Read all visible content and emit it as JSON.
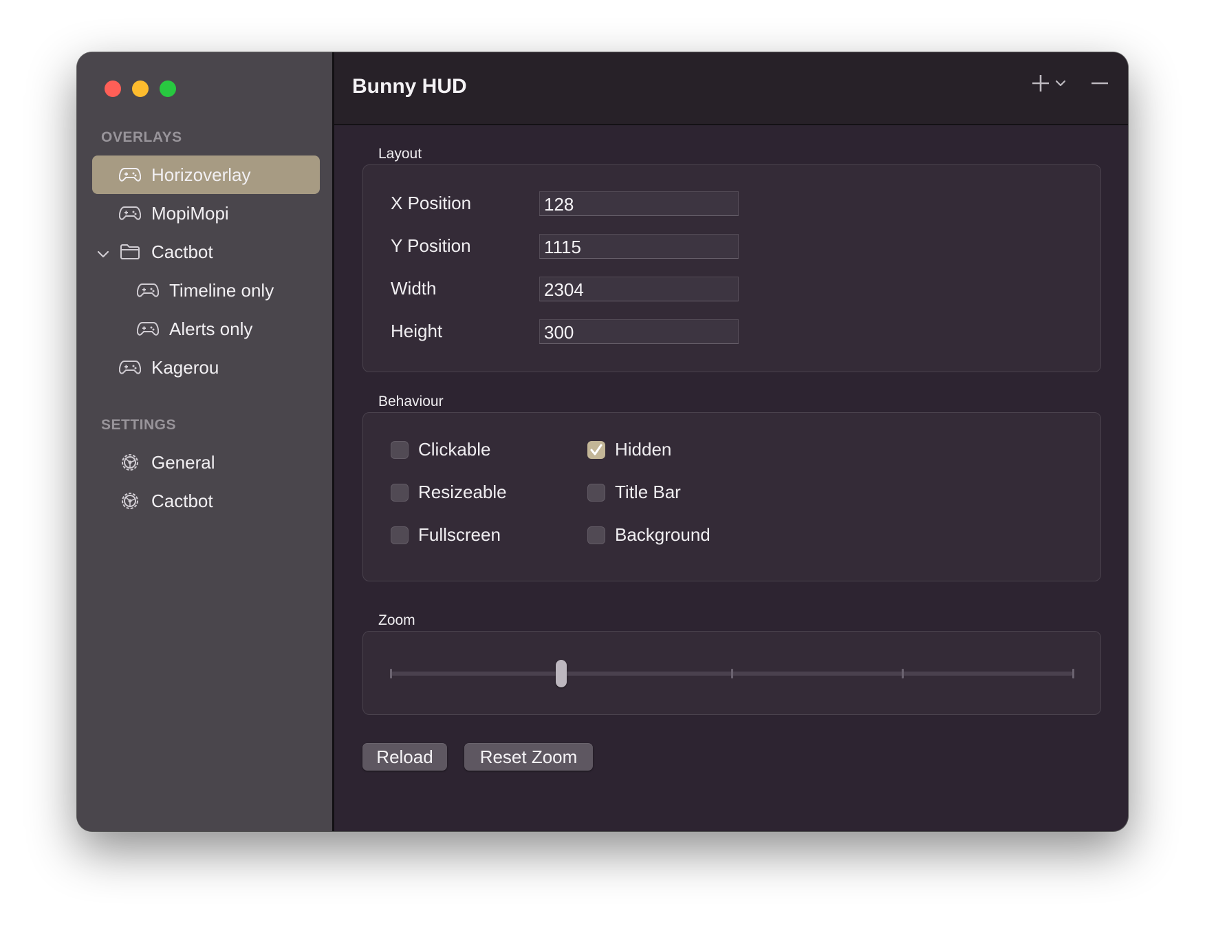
{
  "window": {
    "title": "Bunny HUD"
  },
  "sidebar": {
    "overlays_label": "OVERLAYS",
    "overlays": [
      {
        "label": "Horizoverlay",
        "icon": "gamepad-icon",
        "selected": true
      },
      {
        "label": "MopiMopi",
        "icon": "gamepad-icon"
      },
      {
        "label": "Cactbot",
        "icon": "folder-icon",
        "expanded": true
      },
      {
        "label": "Timeline only",
        "icon": "gamepad-icon"
      },
      {
        "label": "Alerts only",
        "icon": "gamepad-icon"
      },
      {
        "label": "Kagerou",
        "icon": "gamepad-icon"
      }
    ],
    "settings_label": "SETTINGS",
    "settings": [
      {
        "label": "General",
        "icon": "gear-icon"
      },
      {
        "label": "Cactbot",
        "icon": "gear-icon"
      }
    ]
  },
  "layout": {
    "label": "Layout",
    "fields": [
      {
        "label": "X Position",
        "value": "128"
      },
      {
        "label": "Y Position",
        "value": "1115"
      },
      {
        "label": "Width",
        "value": "2304"
      },
      {
        "label": "Height",
        "value": "300"
      }
    ]
  },
  "behaviour": {
    "label": "Behaviour",
    "options": [
      {
        "label": "Clickable",
        "checked": false
      },
      {
        "label": "Hidden",
        "checked": true
      },
      {
        "label": "Resizeable",
        "checked": false
      },
      {
        "label": "Title Bar",
        "checked": false
      },
      {
        "label": "Fullscreen",
        "checked": false
      },
      {
        "label": "Background",
        "checked": false
      }
    ]
  },
  "zoom": {
    "label": "Zoom",
    "value_fraction": 0.25,
    "tick_count": 5
  },
  "buttons": {
    "reload": "Reload",
    "reset_zoom": "Reset Zoom"
  },
  "colors": {
    "accent": "#a79b83",
    "checkbox_on": "#c3b697"
  }
}
